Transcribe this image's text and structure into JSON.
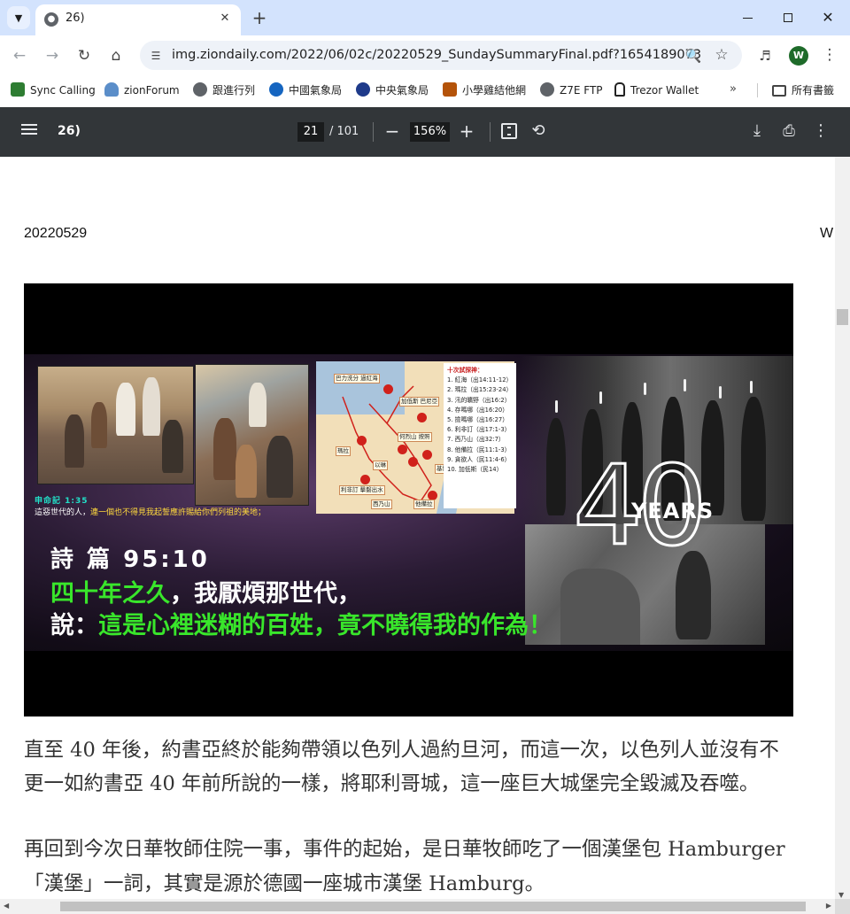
{
  "tab": {
    "title": "26)",
    "favicon": "globe-icon"
  },
  "toolbar": {
    "url": "img.ziondaily.com/2022/06/02c/20220529_SundaySummaryFinal.pdf?1654189073",
    "profile_initial": "W"
  },
  "bookmarks": [
    {
      "label": "Sync Calling",
      "icon": "sync-calling-icon",
      "color": "#2e7d32"
    },
    {
      "label": "zionForum",
      "icon": "zionforum-icon",
      "color": "#5b8ec9"
    },
    {
      "label": "跟進行列",
      "icon": "globe-icon",
      "color": "#5f6368"
    },
    {
      "label": "中國氣象局",
      "icon": "cma-icon",
      "color": "#1565c0"
    },
    {
      "label": "中央氣象局",
      "icon": "cwb-icon",
      "color": "#1e3a8a"
    },
    {
      "label": "小學雞結他網",
      "icon": "guitar-icon",
      "color": "#b45309"
    },
    {
      "label": "Z7E FTP",
      "icon": "globe-icon",
      "color": "#5f6368"
    },
    {
      "label": "Trezor Wallet",
      "icon": "lock-icon",
      "color": "#222222"
    }
  ],
  "bookmarks_more": "»",
  "bookmarks_folder": "所有書籤",
  "pdf": {
    "title": "26)",
    "page_current": "21",
    "page_total": "/ 101",
    "zoom": "156%"
  },
  "document": {
    "date": "20220529",
    "corner": "W",
    "slide": {
      "ref_label": "申命記 1:35",
      "ref_text_white": "這惡世代的人，",
      "ref_text_yellow": "連一個也不得見我起誓應許賜給你們列祖的美地；",
      "verse_title": "詩 篇 95:10",
      "line1_green": "四十年之久",
      "line1_white": "，我厭煩那世代，",
      "line2_white": "說：",
      "line2_green": "這是心裡迷糊的百姓，竟不曉得我的作為！",
      "forty": "40",
      "years": "YEARS",
      "map_labels": [
        "巴力洗分 過紅海",
        "加低斯 巴尼亞",
        "瑪拉",
        "利非訂 擊磐出水",
        "何烈山 按照",
        "以琳",
        "西乃山",
        "他備拉",
        "基博羅 哈他瓦"
      ],
      "list_title": "十次試探神：",
      "list_items": [
        "1. 紅海（出14:11-12）",
        "2. 瑪拉（出15:23-24）",
        "3. 汛的曠野（出16:2）",
        "4. 存嗎哪（出16:20）",
        "5. 撿嗎哪（出16:27）",
        "6. 利非訂（出17:1-3）",
        "7. 西乃山（出32:7）",
        "8. 他備拉（民11:1-3）",
        "9. 貪欲人（民11:4-6）",
        "10. 加低斯（民14）"
      ]
    },
    "paragraphs": [
      "直至 40 年後，約書亞終於能夠帶領以色列人過約旦河，而這一次，以色列人並沒有不",
      "更一如約書亞 40 年前所說的一樣，將耶利哥城，這一座巨大城堡完全毀滅及吞噬。",
      "再回到今次日華牧師住院一事，事件的起始，是日華牧師吃了一個漢堡包 Hamburger",
      "「漢堡」一詞，其實是源於德國一座城市漢堡 Hamburg。"
    ]
  }
}
